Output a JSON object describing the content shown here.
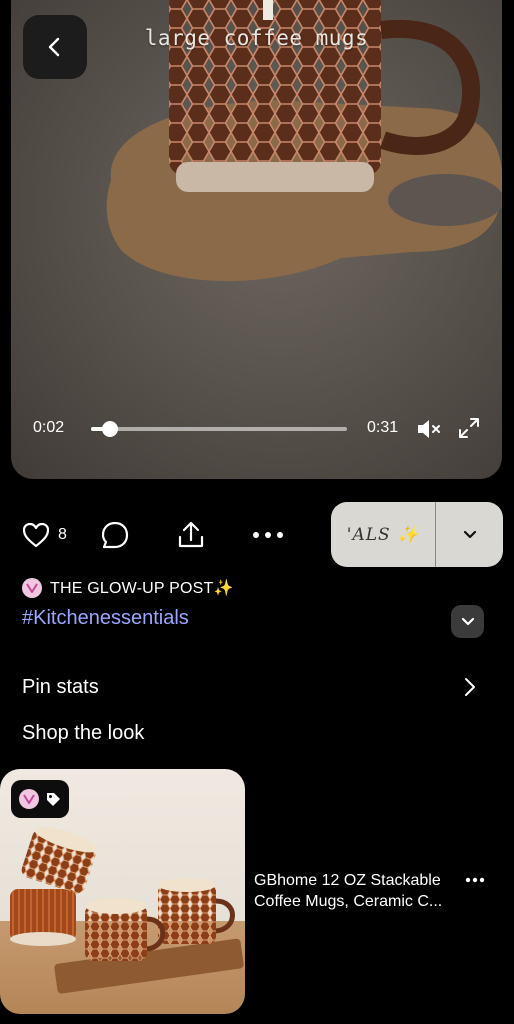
{
  "video": {
    "caption": "large coffee mugs",
    "current_time": "0:02",
    "duration": "0:31",
    "progress": 0.075,
    "muted": true
  },
  "actions": {
    "like_count": "8",
    "save_label": "'ALS ✨"
  },
  "creator": {
    "name": "THE GLOW-UP POST✨"
  },
  "hashtag": "#Kitchenessentials",
  "pin_stats_label": "Pin stats",
  "shop": {
    "title": "Shop the look",
    "product_title": "GBhome 12 OZ Stackable Coffee Mugs, Ceramic C..."
  },
  "colors": {
    "hashtag": "#9aa6ff",
    "save_button_bg": "#d9d8d3",
    "background": "#000000"
  },
  "icons": [
    "back-arrow-icon",
    "mute-icon",
    "fullscreen-icon",
    "heart-icon",
    "comment-icon",
    "share-icon",
    "more-icon",
    "chevron-down-icon",
    "chevron-right-icon",
    "tag-icon"
  ]
}
